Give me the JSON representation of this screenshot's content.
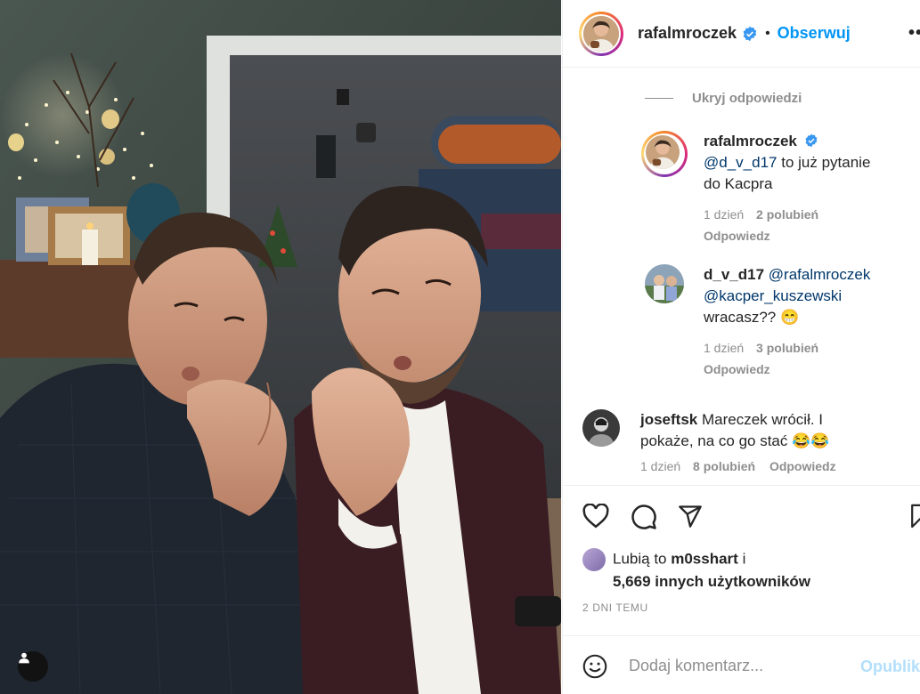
{
  "post": {
    "author": "rafalmroczek",
    "follow_label": "Obserwuj",
    "separator": "•",
    "more_label": "••"
  },
  "comments": {
    "hide_replies_label": "Ukryj odpowiedzi",
    "items": [
      {
        "user": "rafalmroczek",
        "verified": true,
        "mention": "@d_v_d17",
        "text_line1": " to już pytanie",
        "text_line2": "do Kacpra",
        "time": "1 dzień",
        "likes": "2 polubień",
        "reply": "Odpowiedz"
      },
      {
        "user": "d_v_d17",
        "mention": "@rafalmroczek",
        "mention2": "@kacper_kuszewski",
        "text": "wracasz?? 😁",
        "time": "1 dzień",
        "likes": "3 polubień",
        "reply": "Odpowiedz"
      },
      {
        "user": "joseftsk",
        "text_line1": "Mareczek wrócił. I",
        "text_line2": "pokaże, na co go stać 😂😂",
        "time": "1 dzień",
        "likes": "8 polubień",
        "reply": "Odpowiedz"
      }
    ]
  },
  "likes": {
    "prefix": "Lubią to ",
    "user": "m0sshart",
    "suffix": " i",
    "count_line": "5,669 innych użytkowników"
  },
  "timestamp": "2 DNI TEMU",
  "add_comment": {
    "placeholder": "Dodaj komentarz...",
    "publish_label": "Opublikuj"
  },
  "icons": {
    "heart": "heart-icon",
    "comment": "comment-icon",
    "share": "share-icon",
    "save": "bookmark-icon",
    "emoji": "emoji-icon",
    "user_tag": "user-tag-icon",
    "verified": "verified-badge-icon"
  },
  "colors": {
    "link_blue": "#0095f6",
    "mention_blue": "#00376b",
    "muted_gray": "#8e8e8e",
    "publish_disabled": "#b2dffc"
  }
}
